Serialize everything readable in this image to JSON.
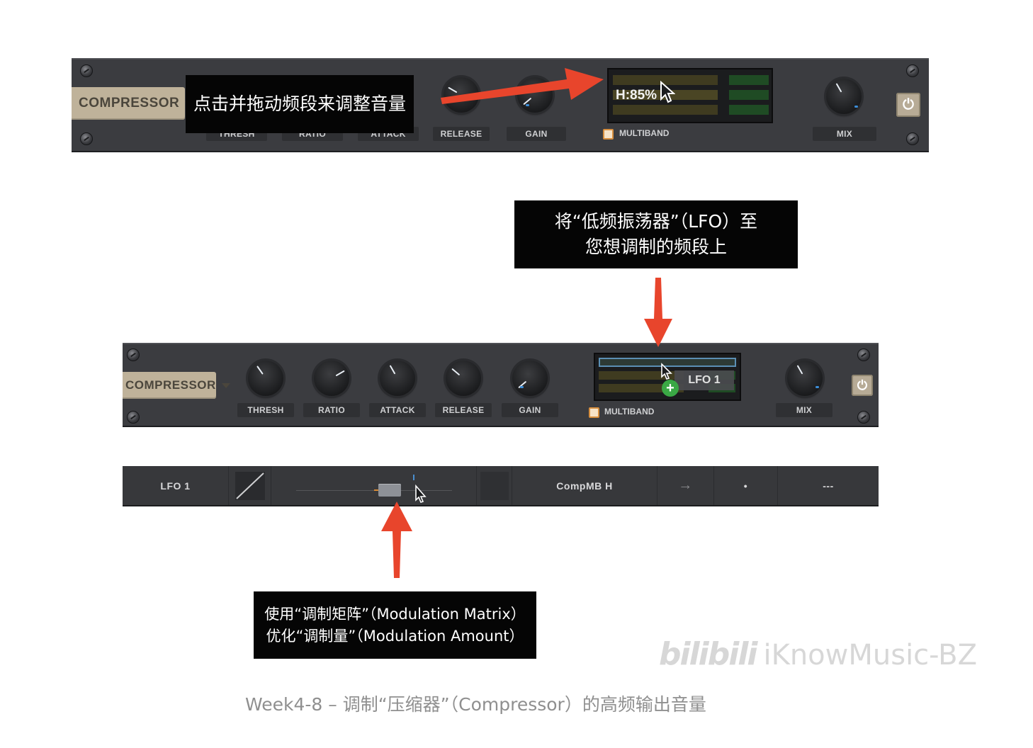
{
  "top_panel": {
    "title": "COMPRESSOR",
    "knobs": [
      "RELEASE",
      "GAIN"
    ],
    "hidden_labels": [
      "THRESH",
      "RATIO",
      "ATTACK"
    ],
    "display_readout": "H:85%",
    "multiband_label": "MULTIBAND",
    "mix_label": "MIX"
  },
  "top_callout": "点击并拖动频段来调整音量",
  "middle_callout": {
    "line1": "将“低频振荡器”（LFO）至",
    "line2": "您想调制的频段上"
  },
  "bottom_panel": {
    "title": "COMPRESSOR",
    "knobs": [
      "THRESH",
      "RATIO",
      "ATTACK",
      "RELEASE",
      "GAIN"
    ],
    "drag_label": "LFO 1",
    "multiband_label": "MULTIBAND",
    "mix_label": "MIX"
  },
  "mod_matrix": {
    "source": "LFO 1",
    "destination": "CompMB H",
    "direction": "→",
    "dot": "•",
    "dashes": "---",
    "amount_fraction": 0.6
  },
  "bottom_callout": {
    "line1": "使用“调制矩阵”（Modulation Matrix）",
    "line2": "优化“调制量”（Modulation Amount）"
  },
  "caption": "Week4-8 – 调制“压缩器”（Compressor）的高频输出音量",
  "watermark": "iKnowMusic-BZ",
  "colors": {
    "arrow": "#e8452c",
    "panel": "#3b3c40",
    "tab": "#bfb29a",
    "checkbox": "#d78f3f",
    "plus_button": "#3aa845"
  }
}
